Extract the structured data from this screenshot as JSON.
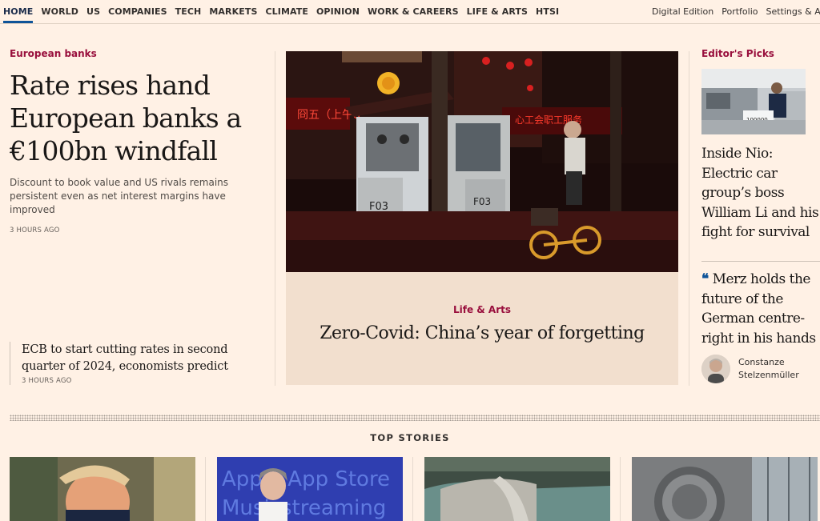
{
  "nav": {
    "items": [
      "HOME",
      "WORLD",
      "US",
      "COMPANIES",
      "TECH",
      "MARKETS",
      "CLIMATE",
      "OPINION",
      "WORK & CAREERS",
      "LIFE & ARTS",
      "HTSI"
    ],
    "right": [
      "Digital Edition",
      "Portfolio",
      "Settings & Account"
    ]
  },
  "lead": {
    "kicker": "European banks",
    "headline": "Rate rises hand European banks a €100bn windfall",
    "standfirst": "Discount to book value and US rivals remains persistent even as net interest margins have improved",
    "timestamp": "3 HOURS AGO"
  },
  "sub_story": {
    "headline": "ECB to start cutting rates in second quarter of 2024, economists predict",
    "timestamp": "3 HOURS AGO"
  },
  "hero": {
    "kicker": "Life & Arts",
    "headline": "Zero-Covid: China’s year of forgetting",
    "image_alt": "cyclist-near-covid-testing-booth-photo"
  },
  "editors_picks": {
    "label": "Editor's Picks",
    "headline": "Inside Nio: Electric car group’s boss William Li and his fight for survival"
  },
  "opinion": {
    "quote_mark": "❝",
    "headline": "Merz holds the future of the German centre-right in his hands",
    "author": "Constanze Stelzenmüller"
  },
  "top_stories": {
    "title": "TOP STORIES"
  },
  "colors": {
    "background": "#fff1e5",
    "claret": "#990f3d",
    "oxford": "#0f5499"
  }
}
